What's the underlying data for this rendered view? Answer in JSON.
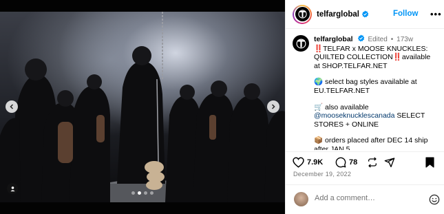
{
  "post": {
    "username": "telfarglobal",
    "follow_label": "Follow",
    "more_label": "•••",
    "carousel": {
      "total": 4,
      "active_index": 1
    }
  },
  "caption": {
    "username": "telfarglobal",
    "edited": "Edited",
    "separator": "•",
    "age": "173w",
    "line1": "‼️TELFAR x MOOSE KNUCKLES: QUILTED COLLECTION‼️available at SHOP.TELFAR.NET",
    "line2_icon": "🌍",
    "line2": "select bag styles available at EU.TELFAR.NET",
    "line3_icon": "🛒",
    "line3_pre": "also available",
    "line3_mention": "@mooseknucklescanada",
    "line3_post": "SELECT STORES + ONLINE",
    "line4_icon": "📦",
    "line4": "orders placed after DEC 14 ship after JAN 5"
  },
  "actions": {
    "likes": "7.9K",
    "comments": "78"
  },
  "date": "December 19, 2022",
  "comment_box": {
    "placeholder": "Add a comment…"
  },
  "icons": {
    "like": "heart-icon",
    "comment": "comment-bubble-icon",
    "repost": "repost-icon",
    "share": "share-paper-plane-icon",
    "save": "bookmark-icon",
    "emoji": "emoji-smile-icon",
    "verified": "verified-badge-icon",
    "prev": "chevron-left-icon",
    "next": "chevron-right-icon",
    "tag": "user-tag-icon"
  },
  "colors": {
    "follow": "#0095f6",
    "verified": "#0095f6",
    "mention": "#00376b",
    "muted": "#737373"
  }
}
